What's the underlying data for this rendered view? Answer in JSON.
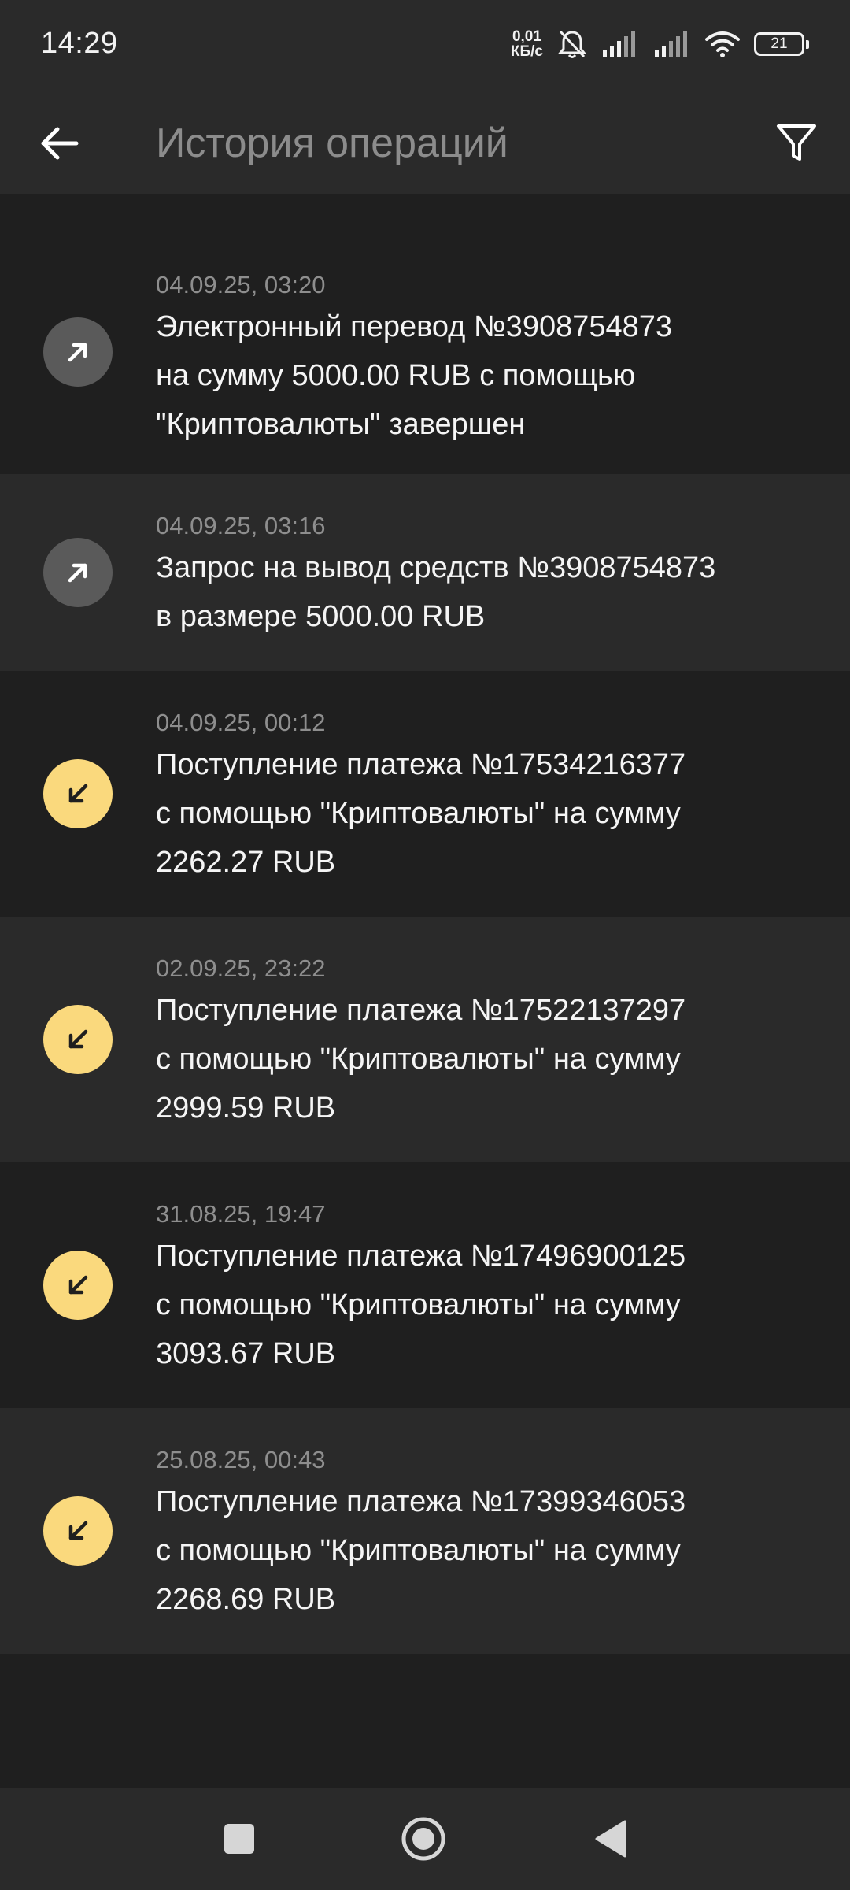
{
  "status_bar": {
    "time": "14:29",
    "net_speed_value": "0,01",
    "net_speed_unit": "КБ/с",
    "battery": "21",
    "icons": [
      "bell-off-icon",
      "signal-icon",
      "signal-icon",
      "wifi-icon",
      "battery-icon"
    ]
  },
  "header": {
    "title": "История операций",
    "back_icon": "arrow-left-icon",
    "filter_icon": "filter-icon"
  },
  "operations": [
    {
      "date": "04.09.25, 03:20",
      "text": "Электронный перевод №3908754873\nна сумму 5000.00 RUB с помощью\n\"Криптовалюты\" завершен",
      "direction": "outgoing",
      "icon": "arrow-up-right-icon"
    },
    {
      "date": "04.09.25, 03:16",
      "text": "Запрос на вывод средств №3908754873\nв размере 5000.00 RUB",
      "direction": "outgoing",
      "icon": "arrow-up-right-icon"
    },
    {
      "date": "04.09.25, 00:12",
      "text": "Поступление платежа №17534216377\nс помощью \"Криптовалюты\" на сумму\n2262.27 RUB",
      "direction": "incoming",
      "icon": "arrow-down-left-icon"
    },
    {
      "date": "02.09.25, 23:22",
      "text": "Поступление платежа №17522137297\nс помощью \"Криптовалюты\" на сумму\n2999.59 RUB",
      "direction": "incoming",
      "icon": "arrow-down-left-icon"
    },
    {
      "date": "31.08.25, 19:47",
      "text": "Поступление платежа №17496900125\nс помощью \"Криптовалюты\" на сумму\n3093.67 RUB",
      "direction": "incoming",
      "icon": "arrow-down-left-icon"
    },
    {
      "date": "25.08.25, 00:43",
      "text": "Поступление платежа №17399346053\nс помощью \"Криптовалюты\" на сумму\n2268.69 RUB",
      "direction": "incoming",
      "icon": "arrow-down-left-icon"
    }
  ],
  "colors": {
    "background": "#1f1f1f",
    "row_alt": "#2a2a2a",
    "incoming_accent": "#fad97d",
    "outgoing_accent": "#5a5a5a",
    "secondary_text": "#8e8e8e"
  },
  "nav_bar": {
    "icons": [
      "recents-square-icon",
      "home-circle-icon",
      "back-triangle-icon"
    ]
  }
}
